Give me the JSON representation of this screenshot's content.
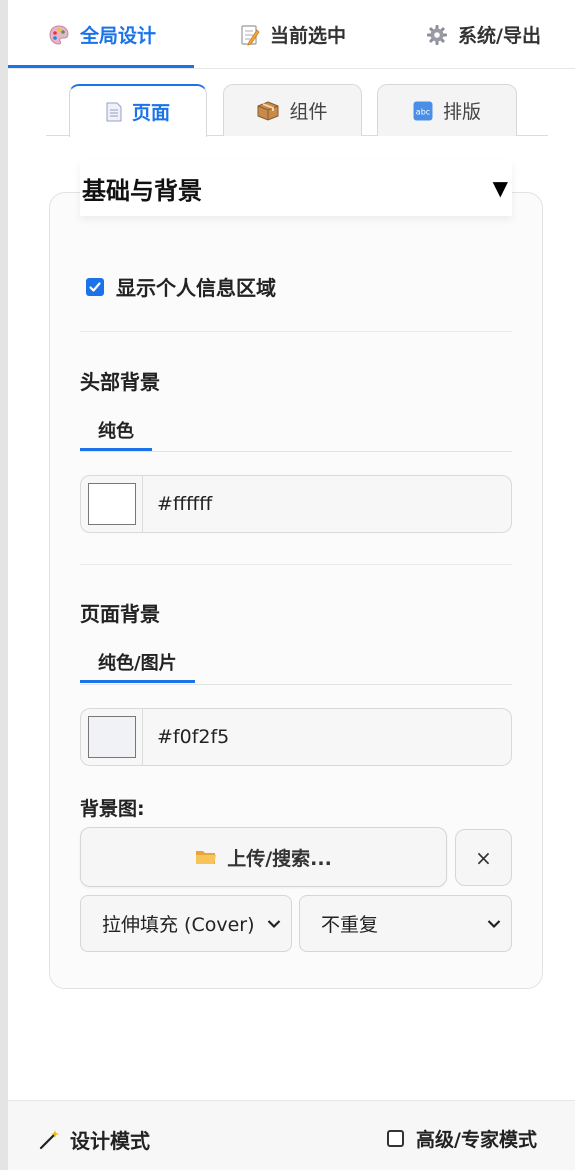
{
  "top_tabs": [
    {
      "label": "全局设计",
      "icon": "palette-icon",
      "active": true
    },
    {
      "label": "当前选中",
      "icon": "memo-icon",
      "active": false
    },
    {
      "label": "系统/导出",
      "icon": "gear-icon",
      "active": false
    }
  ],
  "sub_tabs": [
    {
      "label": "页面",
      "icon": "page-icon",
      "active": true
    },
    {
      "label": "组件",
      "icon": "package-icon",
      "active": false
    },
    {
      "label": "排版",
      "icon": "abc-icon",
      "active": false
    }
  ],
  "section": {
    "title": "基础与背景",
    "caret": "▼"
  },
  "show_profile": {
    "label": "显示个人信息区域",
    "checked": true
  },
  "header_bg": {
    "label": "头部背景",
    "tab": "纯色",
    "color": "#ffffff",
    "hex_text": "#ffffff"
  },
  "page_bg": {
    "label": "页面背景",
    "tab": "纯色/图片",
    "color": "#f0f2f5",
    "hex_text": "#f0f2f5",
    "bg_image_label": "背景图:",
    "upload_label": "上传/搜索...",
    "clear_label": "×",
    "size_select": "拉伸填充 (Cover)",
    "repeat_select": "不重复"
  },
  "footer": {
    "mode_label": "设计模式",
    "expert_label": "高级/专家模式",
    "expert_checked": false
  },
  "colors": {
    "accent": "#1a73e8"
  }
}
